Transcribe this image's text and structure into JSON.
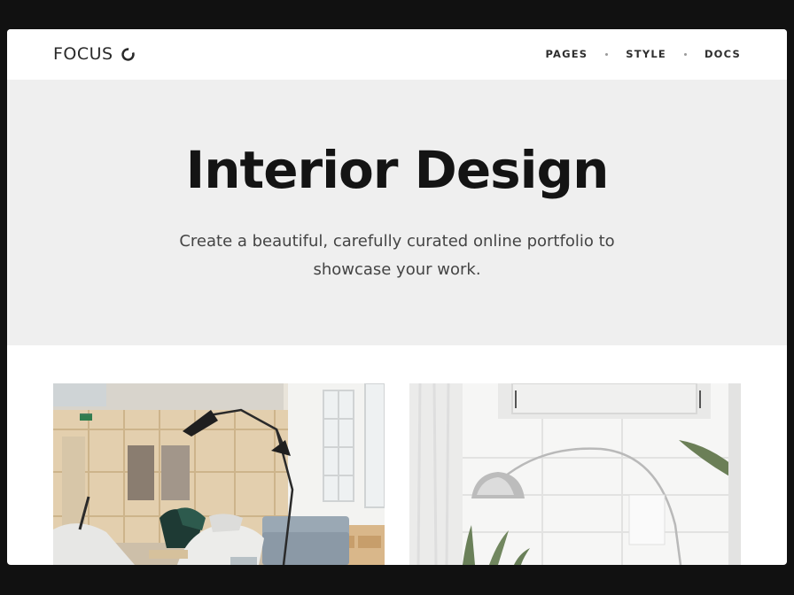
{
  "header": {
    "logo_text": "FOCUS",
    "logo_icon": "circle-notch-icon",
    "nav": [
      {
        "label": "PAGES"
      },
      {
        "label": "STYLE"
      },
      {
        "label": "DOCS"
      }
    ]
  },
  "hero": {
    "title": "Interior Design",
    "subtitle": "Create a beautiful, carefully curated online portfolio to showcase your work."
  },
  "gallery": {
    "items": [
      {
        "image": "office-lounge-photo"
      },
      {
        "image": "white-room-arc-lamp-photo"
      }
    ]
  },
  "colors": {
    "hero_bg": "#efefef",
    "header_bg": "#ffffff",
    "outer_bg": "#111111",
    "title_color": "#141414"
  }
}
